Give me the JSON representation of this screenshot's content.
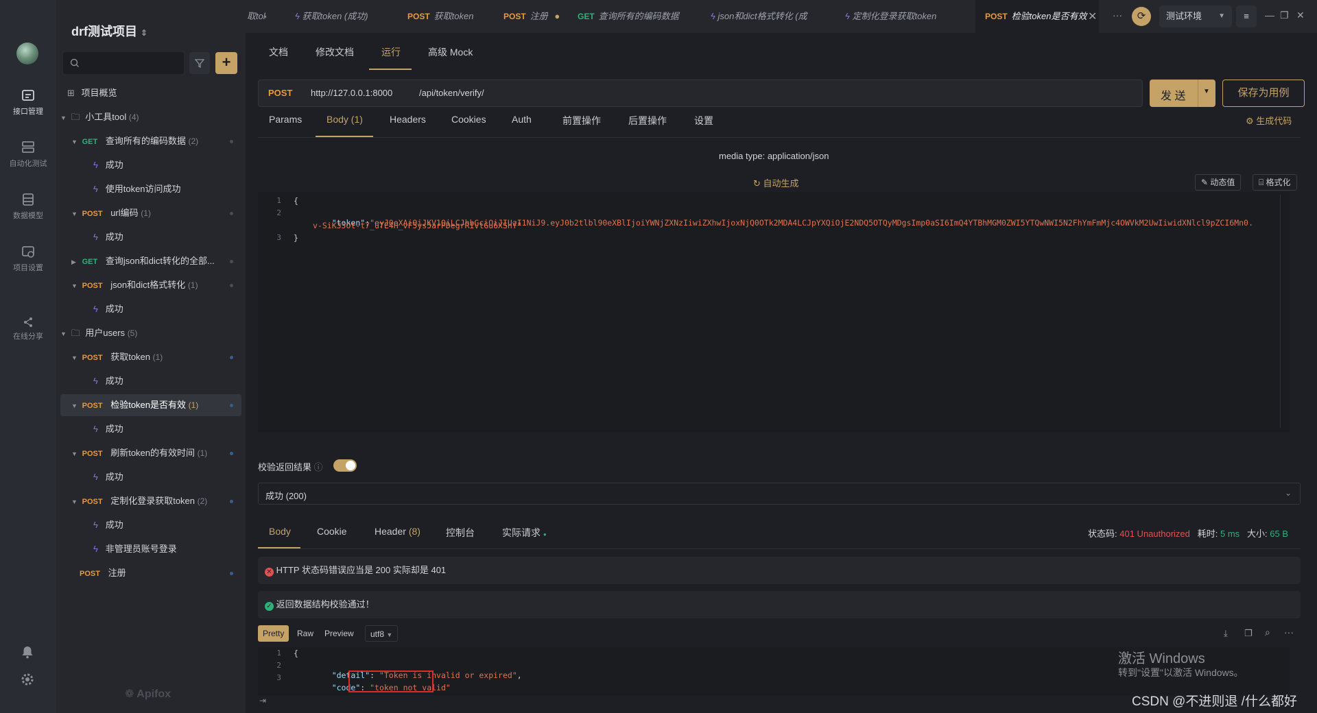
{
  "tree": {
    "project_title": "drf测试项目",
    "brand": "Apifox",
    "items": [
      {
        "label": "项目概览",
        "method": "",
        "count": ""
      },
      {
        "label": "小工具tool",
        "method": "",
        "count": "(4)"
      },
      {
        "label": "查询所有的编码数据",
        "method": "GET",
        "count": "(2)"
      },
      {
        "label": "成功",
        "method": "",
        "count": ""
      },
      {
        "label": "使用token访问成功",
        "method": "",
        "count": ""
      },
      {
        "label": "url编码",
        "method": "POST",
        "count": "(1)"
      },
      {
        "label": "成功",
        "method": "",
        "count": ""
      },
      {
        "label": "查询json和dict转化的全部...",
        "method": "GET",
        "count": ""
      },
      {
        "label": "json和dict格式转化",
        "method": "POST",
        "count": "(1)"
      },
      {
        "label": "成功",
        "method": "",
        "count": ""
      },
      {
        "label": "用户users",
        "method": "",
        "count": "(5)"
      },
      {
        "label": "获取token",
        "method": "POST",
        "count": "(1)"
      },
      {
        "label": "成功",
        "method": "",
        "count": ""
      },
      {
        "label": "检验token是否有效",
        "method": "POST",
        "count": "(1)"
      },
      {
        "label": "成功",
        "method": "",
        "count": ""
      },
      {
        "label": "刷新token的有效时间",
        "method": "POST",
        "count": "(1)"
      },
      {
        "label": "成功",
        "method": "",
        "count": ""
      },
      {
        "label": "定制化登录获取token",
        "method": "POST",
        "count": "(2)"
      },
      {
        "label": "成功",
        "method": "",
        "count": ""
      },
      {
        "label": "非管理员账号登录",
        "method": "",
        "count": ""
      },
      {
        "label": "注册",
        "method": "POST",
        "count": ""
      }
    ]
  },
  "rail": {
    "items": [
      "接口管理",
      "自动化测试",
      "数据模型",
      "项目设置",
      "在线分享"
    ]
  },
  "tabs": [
    {
      "method": "",
      "label": "获取token (成功)"
    },
    {
      "method": "POST",
      "label": "获取token"
    },
    {
      "method": "POST",
      "label": "注册"
    },
    {
      "method": "GET",
      "label": "查询所有的编码数据"
    },
    {
      "method": "",
      "label": "json和dict格式转化 (成"
    },
    {
      "method": "",
      "label": "定制化登录获取token"
    },
    {
      "method": "POST",
      "label": "检验token是否有效"
    }
  ],
  "tab_partial": "取tok",
  "tab_more": "···",
  "env": {
    "label": "测试环境"
  },
  "subtabs": [
    "文档",
    "修改文档",
    "运行",
    "高级 Mock"
  ],
  "request": {
    "method": "POST",
    "host": "http://127.0.0.1:8000",
    "path": "/api/token/verify/",
    "send": "发 送",
    "save": "保存为用例"
  },
  "param_tabs": [
    "Params",
    "Body (1)",
    "Headers",
    "Cookies",
    "Auth",
    "前置操作",
    "后置操作",
    "设置"
  ],
  "gen_code": "生成代码",
  "body": {
    "media_type": "media type: application/json",
    "auto_gen": "自动生成",
    "dynamic": "动态值",
    "format": "格式化",
    "line_numbers": [
      "1",
      "2",
      "3"
    ],
    "open_brace": "{",
    "token_key": "\"token\"",
    "colon": ":",
    "token_value_1": "\"eyJ0eXAiOiJKV1QiLCJhbGciOiJIUzI1NiJ9.eyJ0b2tlbl90eXBlIjoiYWNjZXNzIiwiZXhwIjoxNjQ0OTk2MDA4LCJpYXQiOjE2NDQ5OTQyMDgsImp0aSI6ImQ4YTBhMGM0ZWI5YTQwNWI5N2FhYmFmMjc4OWVkM2UwIiwidXNlcl9pZCI6Mn0.",
    "token_value_2": "v-SiK35Ot-t7_uTE4H_vF5ys5arPDegrRIvtGu6XShY\"",
    "close_brace": "}"
  },
  "validate": {
    "label": "校验返回结果",
    "selected": "成功 (200)"
  },
  "response": {
    "tabs": [
      "Body",
      "Cookie",
      "Header",
      "(8)",
      "控制台",
      "实际请求"
    ],
    "status_label": "状态码:",
    "status_value": "401 Unauthorized",
    "time_label": "耗时:",
    "time_value": "5 ms",
    "size_label": "大小:",
    "size_value": "65 B",
    "error_msg": "HTTP 状态码错误应当是 200 实际却是 401",
    "ok_msg": "返回数据结构校验通过！",
    "view_tabs": [
      "Pretty",
      "Raw",
      "Preview"
    ],
    "encoding": "utf8",
    "line_numbers": [
      "1",
      "2",
      "3"
    ],
    "open_brace": "{",
    "detail_key": "\"detail\"",
    "detail_value": "\"Token is invalid or expired\"",
    "code_key": "\"code\"",
    "code_value": "\"token_not_valid\""
  },
  "watermark": {
    "line1": "激活 Windows",
    "line2": "转到\"设置\"以激活 Windows。"
  },
  "csdn": "CSDN @不进则退 /什么都好",
  "colors": {
    "accent": "#c5a367",
    "get": "#2fb07a",
    "post": "#e89a3c",
    "error": "#e05252",
    "success": "#2fb07a"
  }
}
